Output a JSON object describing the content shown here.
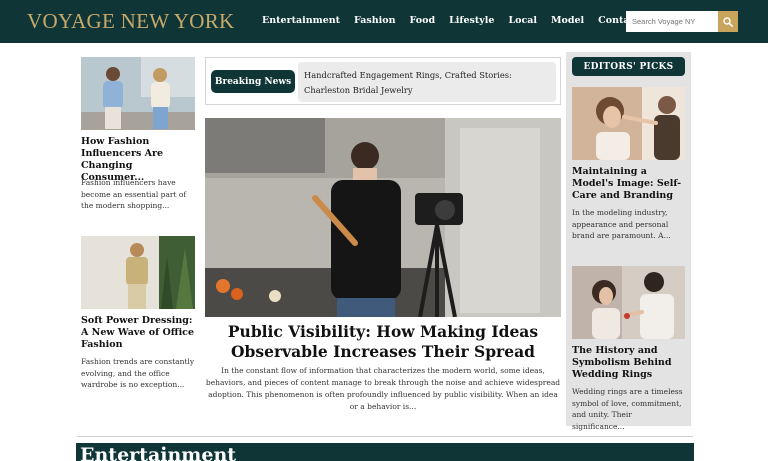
{
  "header": {
    "logo": "VOYAGE NEW YORK",
    "nav": [
      "Entertainment",
      "Fashion",
      "Food",
      "Lifestyle",
      "Local",
      "Model",
      "Contact Us"
    ],
    "search_placeholder": "Search Voyage NY"
  },
  "left_column": [
    {
      "title": "How Fashion Influencers Are Changing Consumer...",
      "excerpt": "Fashion influencers have become an essential part of the modern shopping..."
    },
    {
      "title": "Soft Power Dressing: A New Wave of Office Fashion",
      "excerpt": "Fashion trends are constantly evolving, and the office wardrobe is no exception..."
    }
  ],
  "breaking_news": {
    "label": "Breaking News",
    "headline": "Handcrafted Engagement Rings, Crafted Stories: Charleston Bridal Jewelry"
  },
  "hero": {
    "title": "Public Visibility: How Making Ideas Observable Increases Their Spread",
    "excerpt": "In the constant flow of information that characterizes the modern world, some ideas, behaviors, and pieces of content manage to break through the noise and achieve widespread adoption. This phenomenon is often profoundly influenced by public visibility. When an idea or a behavior is..."
  },
  "editors_picks": {
    "heading": "EDITORS' PICKS",
    "items": [
      {
        "title": "Maintaining a Model's Image: Self-Care and Branding",
        "excerpt": "In the modeling industry, appearance and personal brand are paramount. A..."
      },
      {
        "title": "The History and Symbolism Behind Wedding Rings",
        "excerpt": "Wedding rings are a timeless symbol of love, commitment, and unity. Their significance..."
      }
    ]
  },
  "section": {
    "title": "Entertainment"
  },
  "colors": {
    "brand_dark": "#0f3536",
    "logo_gold": "#c8a96a",
    "search_button": "#c8a45c"
  }
}
